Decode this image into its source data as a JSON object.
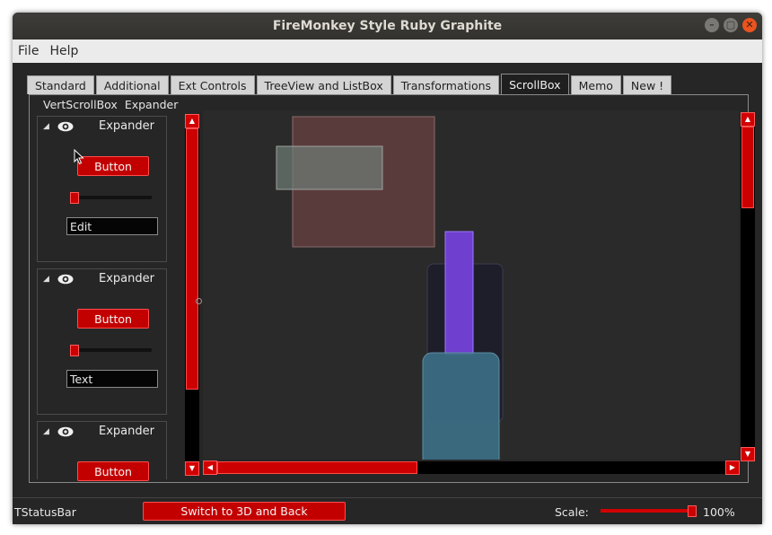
{
  "window": {
    "title": "FireMonkey Style Ruby Graphite",
    "controls": [
      "minimize",
      "maximize",
      "close"
    ]
  },
  "menu": {
    "items": [
      "File",
      "Help"
    ]
  },
  "tabs": {
    "items": [
      "Standard",
      "Additional",
      "Ext Controls",
      "TreeView and ListBox",
      "Transformations",
      "ScrollBox",
      "Memo",
      "New !"
    ],
    "active": "ScrollBox"
  },
  "left_panel": {
    "header": {
      "vert_label": "VertScrollBox",
      "expander_label": "Expander"
    },
    "expanders": [
      {
        "title": "Expander",
        "button": "Button",
        "slider_value": 0.02,
        "edit_value": "Edit"
      },
      {
        "title": "Expander",
        "button": "Button",
        "slider_value": 0.02,
        "edit_value": "Text"
      },
      {
        "title": "Expander",
        "button": "Button"
      }
    ],
    "vscroll_thumb_fraction": 0.78
  },
  "scrollbox": {
    "vscroll_thumb_fraction": 0.25,
    "hscroll_thumb_fraction": 0.39
  },
  "statusbar": {
    "label": "TStatusBar",
    "switch_button": "Switch to 3D and Back",
    "scale_label": "Scale:",
    "scale_value": "100%",
    "scale_fraction": 0.97
  },
  "colors": {
    "accent": "#cc0000",
    "panel": "#262626",
    "shape_brown": "#5a3b3b",
    "shape_grey": "#6f7f78",
    "shape_purple": "#6f3fcf",
    "shape_teal": "#3c6e84"
  }
}
